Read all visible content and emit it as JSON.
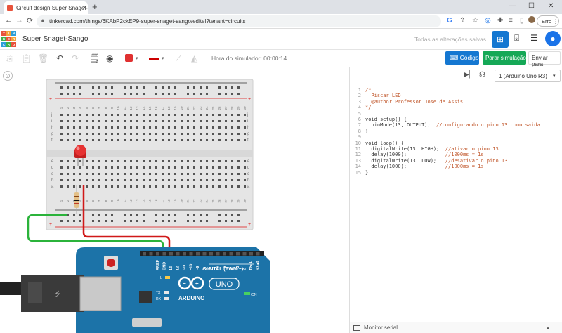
{
  "browser": {
    "tab_title": "Circuit design Super Snaget-Sa",
    "tab_close": "✕",
    "new_tab": "+",
    "url": "tinkercad.com/things/6KAbP2ckEP9-super-snaget-sango/editel?tenant=circuits",
    "error_label": "Erro",
    "back": "←",
    "forward": "→",
    "reload": "⟳",
    "minimize": "—",
    "maximize": "☐",
    "close": "✕"
  },
  "logo": {
    "cells": [
      "TIN",
      "KER",
      "CAD"
    ],
    "colors": [
      "#e8533c",
      "#f3a33a",
      "#2c9fd9",
      "#3fb24a"
    ]
  },
  "header": {
    "project_title": "Super Snaget-Sango",
    "saved_status": "Todas as alterações salvas"
  },
  "toolbar": {
    "sim_time": "Hora do simulador: 00:00:14",
    "code_button": "Código",
    "sim_button": "Parar simulação",
    "send_button": "Enviar para"
  },
  "code_panel": {
    "device": "1 (Arduino Uno R3)",
    "serial_monitor": "Monitor serial",
    "lines": [
      {
        "n": "1",
        "text": "/*",
        "cls": "cm"
      },
      {
        "n": "2",
        "text": "  Piscar LED",
        "cls": "cm"
      },
      {
        "n": "3",
        "text": "  @author Professor Jose de Assis",
        "cls": "cm"
      },
      {
        "n": "4",
        "text": "*/",
        "cls": "cm"
      },
      {
        "n": "5",
        "text": "",
        "cls": "kw"
      },
      {
        "n": "6",
        "text": "void setup() {",
        "cls": "kw"
      },
      {
        "n": "7",
        "text": "  pinMode(13, OUTPUT);  //configurando o pino 13 como saida",
        "cls": "kw"
      },
      {
        "n": "8",
        "text": "}",
        "cls": "kw"
      },
      {
        "n": "9",
        "text": "",
        "cls": "kw"
      },
      {
        "n": "10",
        "text": "void loop() {",
        "cls": "kw"
      },
      {
        "n": "11",
        "text": "  digitalWrite(13, HIGH);  //ativar o pino 13",
        "cls": "kw"
      },
      {
        "n": "12",
        "text": "  delay(1000);             //1000ms = 1s",
        "cls": "kw"
      },
      {
        "n": "13",
        "text": "  digitalWrite(13, LOW);   //desativar o pino 13",
        "cls": "kw"
      },
      {
        "n": "14",
        "text": "  delay(1000);             //1000ms = 1s",
        "cls": "kw"
      },
      {
        "n": "15",
        "text": "}",
        "cls": "kw"
      }
    ]
  },
  "breadboard": {
    "column_numbers": [
      "1",
      "2",
      "3",
      "4",
      "5",
      "6",
      "7",
      "8",
      "9",
      "10",
      "11",
      "12",
      "13",
      "14",
      "15",
      "16",
      "17",
      "18",
      "19",
      "20",
      "21",
      "22",
      "23",
      "24",
      "25",
      "26",
      "27",
      "28",
      "29",
      "30"
    ],
    "row_letters_top": [
      "j",
      "i",
      "h",
      "g",
      "f"
    ],
    "row_letters_bottom": [
      "e",
      "d",
      "c",
      "b",
      "a"
    ],
    "rail_plus": "+",
    "rail_minus": "−"
  },
  "arduino": {
    "brand": "ARDUINO",
    "model": "UNO",
    "digital_label": "DIGITAL (PWM ~)",
    "pins": [
      "AREF",
      "GND",
      "13",
      "12",
      "~11",
      "~10",
      "~9",
      "8",
      "7",
      "~6",
      "~5",
      "4",
      "~3",
      "2",
      "TX▸1",
      "RX◂0"
    ],
    "tx": "TX",
    "rx": "RX",
    "l": "L",
    "on": "ON"
  }
}
